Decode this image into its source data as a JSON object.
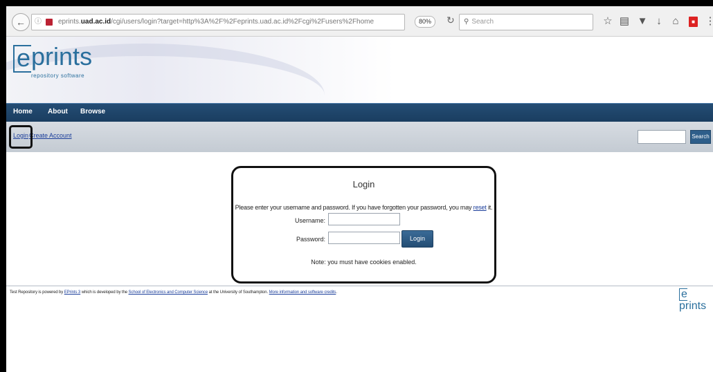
{
  "browser": {
    "url_prefix": "eprints.",
    "url_domain": "uad.ac.id",
    "url_path": "/cgi/users/login?target=http%3A%2F%2Feprints.uad.ac.id%2Fcgi%2Fusers%2Fhome",
    "zoom": "80%",
    "search_placeholder": "Search"
  },
  "logo": {
    "e": "e",
    "rest": "prints",
    "sub": "repository software"
  },
  "nav": {
    "home": "Home",
    "about": "About",
    "browse": "Browse"
  },
  "userbar": {
    "login": "Login",
    "create_account": "Create Account",
    "search_button": "Search"
  },
  "login": {
    "title": "Login",
    "message_prefix": "Please enter your username and password. If you have forgotten your password, you may ",
    "reset_link": "reset",
    "message_suffix": " it.",
    "username_label": "Username:",
    "password_label": "Password:",
    "button": "Login",
    "note": "Note: you must have cookies enabled."
  },
  "footer": {
    "text_1": "Test Repository is powered by ",
    "link_eprints": "EPrints 3",
    "text_2": " which is developed by the ",
    "link_school": "School of Electronics and Computer Science",
    "text_3": " at the University of Southampton. ",
    "link_more": "More information and software credits",
    "text_4": ".",
    "logo_e": "e",
    "logo_rest": "prints"
  }
}
